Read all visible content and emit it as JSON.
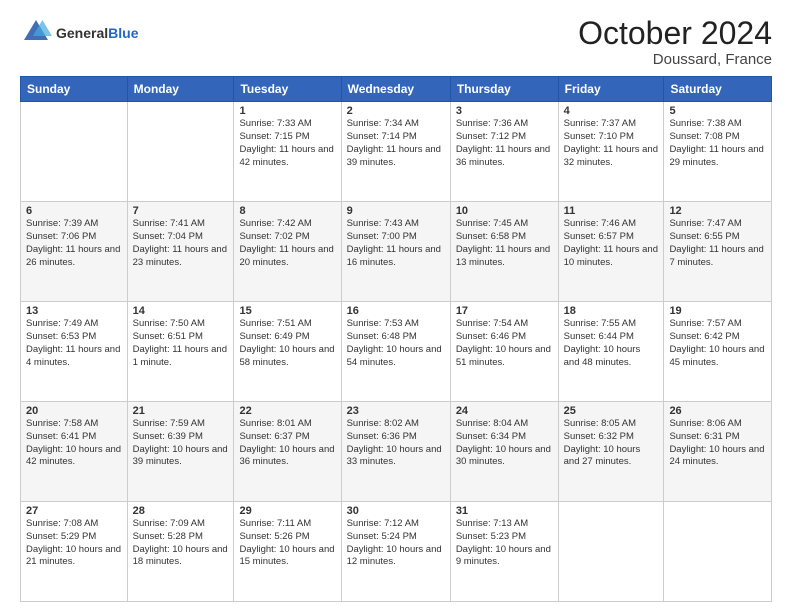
{
  "header": {
    "logo_text_general": "General",
    "logo_text_blue": "Blue",
    "month": "October 2024",
    "location": "Doussard, France"
  },
  "days_of_week": [
    "Sunday",
    "Monday",
    "Tuesday",
    "Wednesday",
    "Thursday",
    "Friday",
    "Saturday"
  ],
  "weeks": [
    [
      {
        "day": "",
        "info": ""
      },
      {
        "day": "",
        "info": ""
      },
      {
        "day": "1",
        "info": "Sunrise: 7:33 AM\nSunset: 7:15 PM\nDaylight: 11 hours and 42 minutes."
      },
      {
        "day": "2",
        "info": "Sunrise: 7:34 AM\nSunset: 7:14 PM\nDaylight: 11 hours and 39 minutes."
      },
      {
        "day": "3",
        "info": "Sunrise: 7:36 AM\nSunset: 7:12 PM\nDaylight: 11 hours and 36 minutes."
      },
      {
        "day": "4",
        "info": "Sunrise: 7:37 AM\nSunset: 7:10 PM\nDaylight: 11 hours and 32 minutes."
      },
      {
        "day": "5",
        "info": "Sunrise: 7:38 AM\nSunset: 7:08 PM\nDaylight: 11 hours and 29 minutes."
      }
    ],
    [
      {
        "day": "6",
        "info": "Sunrise: 7:39 AM\nSunset: 7:06 PM\nDaylight: 11 hours and 26 minutes."
      },
      {
        "day": "7",
        "info": "Sunrise: 7:41 AM\nSunset: 7:04 PM\nDaylight: 11 hours and 23 minutes."
      },
      {
        "day": "8",
        "info": "Sunrise: 7:42 AM\nSunset: 7:02 PM\nDaylight: 11 hours and 20 minutes."
      },
      {
        "day": "9",
        "info": "Sunrise: 7:43 AM\nSunset: 7:00 PM\nDaylight: 11 hours and 16 minutes."
      },
      {
        "day": "10",
        "info": "Sunrise: 7:45 AM\nSunset: 6:58 PM\nDaylight: 11 hours and 13 minutes."
      },
      {
        "day": "11",
        "info": "Sunrise: 7:46 AM\nSunset: 6:57 PM\nDaylight: 11 hours and 10 minutes."
      },
      {
        "day": "12",
        "info": "Sunrise: 7:47 AM\nSunset: 6:55 PM\nDaylight: 11 hours and 7 minutes."
      }
    ],
    [
      {
        "day": "13",
        "info": "Sunrise: 7:49 AM\nSunset: 6:53 PM\nDaylight: 11 hours and 4 minutes."
      },
      {
        "day": "14",
        "info": "Sunrise: 7:50 AM\nSunset: 6:51 PM\nDaylight: 11 hours and 1 minute."
      },
      {
        "day": "15",
        "info": "Sunrise: 7:51 AM\nSunset: 6:49 PM\nDaylight: 10 hours and 58 minutes."
      },
      {
        "day": "16",
        "info": "Sunrise: 7:53 AM\nSunset: 6:48 PM\nDaylight: 10 hours and 54 minutes."
      },
      {
        "day": "17",
        "info": "Sunrise: 7:54 AM\nSunset: 6:46 PM\nDaylight: 10 hours and 51 minutes."
      },
      {
        "day": "18",
        "info": "Sunrise: 7:55 AM\nSunset: 6:44 PM\nDaylight: 10 hours and 48 minutes."
      },
      {
        "day": "19",
        "info": "Sunrise: 7:57 AM\nSunset: 6:42 PM\nDaylight: 10 hours and 45 minutes."
      }
    ],
    [
      {
        "day": "20",
        "info": "Sunrise: 7:58 AM\nSunset: 6:41 PM\nDaylight: 10 hours and 42 minutes."
      },
      {
        "day": "21",
        "info": "Sunrise: 7:59 AM\nSunset: 6:39 PM\nDaylight: 10 hours and 39 minutes."
      },
      {
        "day": "22",
        "info": "Sunrise: 8:01 AM\nSunset: 6:37 PM\nDaylight: 10 hours and 36 minutes."
      },
      {
        "day": "23",
        "info": "Sunrise: 8:02 AM\nSunset: 6:36 PM\nDaylight: 10 hours and 33 minutes."
      },
      {
        "day": "24",
        "info": "Sunrise: 8:04 AM\nSunset: 6:34 PM\nDaylight: 10 hours and 30 minutes."
      },
      {
        "day": "25",
        "info": "Sunrise: 8:05 AM\nSunset: 6:32 PM\nDaylight: 10 hours and 27 minutes."
      },
      {
        "day": "26",
        "info": "Sunrise: 8:06 AM\nSunset: 6:31 PM\nDaylight: 10 hours and 24 minutes."
      }
    ],
    [
      {
        "day": "27",
        "info": "Sunrise: 7:08 AM\nSunset: 5:29 PM\nDaylight: 10 hours and 21 minutes."
      },
      {
        "day": "28",
        "info": "Sunrise: 7:09 AM\nSunset: 5:28 PM\nDaylight: 10 hours and 18 minutes."
      },
      {
        "day": "29",
        "info": "Sunrise: 7:11 AM\nSunset: 5:26 PM\nDaylight: 10 hours and 15 minutes."
      },
      {
        "day": "30",
        "info": "Sunrise: 7:12 AM\nSunset: 5:24 PM\nDaylight: 10 hours and 12 minutes."
      },
      {
        "day": "31",
        "info": "Sunrise: 7:13 AM\nSunset: 5:23 PM\nDaylight: 10 hours and 9 minutes."
      },
      {
        "day": "",
        "info": ""
      },
      {
        "day": "",
        "info": ""
      }
    ]
  ]
}
